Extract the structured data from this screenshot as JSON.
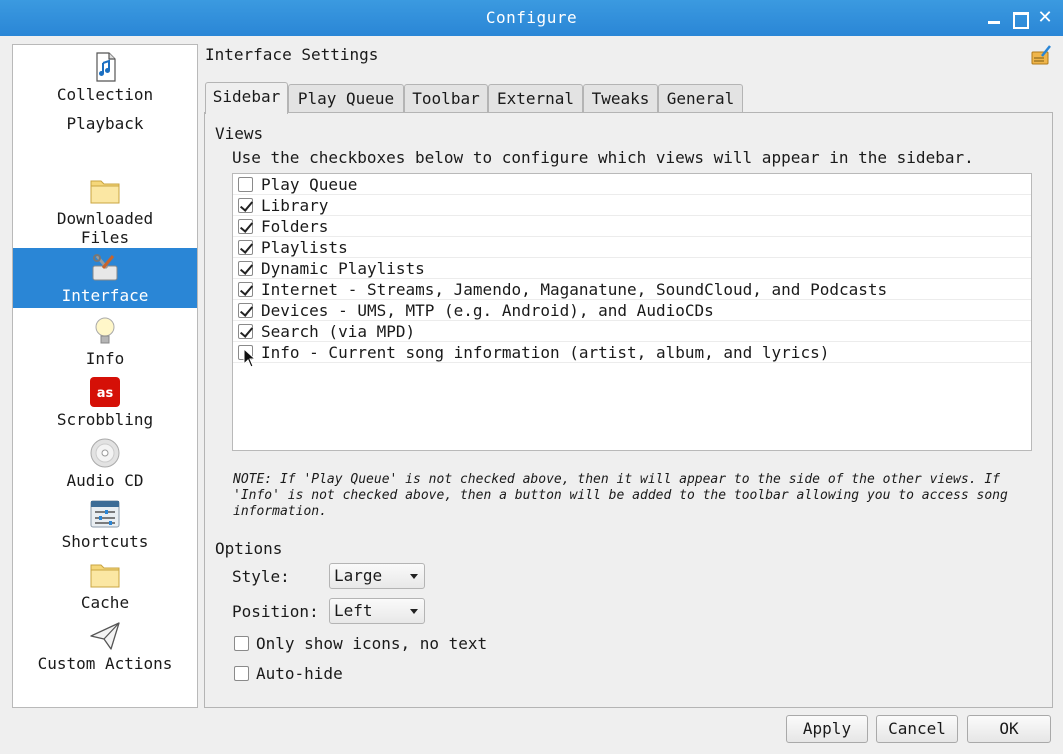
{
  "window": {
    "title": "Configure"
  },
  "sidebar": {
    "items": [
      {
        "label": "Collection",
        "icon": "music-file-icon"
      },
      {
        "label": "Playback",
        "icon": "none"
      },
      {
        "label": "Downloaded Files",
        "icon": "folder-icon"
      },
      {
        "label": "Interface",
        "icon": "tools-icon",
        "selected": true
      },
      {
        "label": "Info",
        "icon": "lightbulb-icon"
      },
      {
        "label": "Scrobbling",
        "icon": "lastfm-icon"
      },
      {
        "label": "Audio CD",
        "icon": "cd-icon"
      },
      {
        "label": "Shortcuts",
        "icon": "sliders-icon"
      },
      {
        "label": "Cache",
        "icon": "folder-icon"
      },
      {
        "label": "Custom Actions",
        "icon": "paper-plane-icon"
      }
    ]
  },
  "page": {
    "title": "Interface Settings"
  },
  "tabs": [
    "Sidebar",
    "Play Queue",
    "Toolbar",
    "External",
    "Tweaks",
    "General"
  ],
  "views": {
    "group_label": "Views",
    "hint": "Use the checkboxes below to configure which views will appear in the sidebar.",
    "items": [
      {
        "label": "Play Queue",
        "checked": false
      },
      {
        "label": "Library",
        "checked": true
      },
      {
        "label": "Folders",
        "checked": true
      },
      {
        "label": "Playlists",
        "checked": true
      },
      {
        "label": "Dynamic Playlists",
        "checked": true
      },
      {
        "label": "Internet - Streams, Jamendo, Maganatune, SoundCloud, and Podcasts",
        "checked": true
      },
      {
        "label": "Devices - UMS, MTP (e.g. Android), and AudioCDs",
        "checked": true
      },
      {
        "label": "Search (via MPD)",
        "checked": true
      },
      {
        "label": "Info - Current song information (artist, album, and lyrics)",
        "checked": false
      }
    ],
    "note": "NOTE: If 'Play Queue' is not checked above, then it will appear to the side of the other views. If 'Info' is not checked above, then a button will be added to the toolbar allowing you to access song information."
  },
  "options": {
    "group_label": "Options",
    "style_label": "Style:",
    "style_value": "Large",
    "position_label": "Position:",
    "position_value": "Left",
    "icons_only_label": "Only show icons, no text",
    "icons_only_checked": false,
    "autohide_label": "Auto-hide",
    "autohide_checked": false
  },
  "buttons": {
    "apply": "Apply",
    "cancel": "Cancel",
    "ok": "OK"
  },
  "colors": {
    "accent": "#2a86d6",
    "lastfm": "#d51007"
  }
}
